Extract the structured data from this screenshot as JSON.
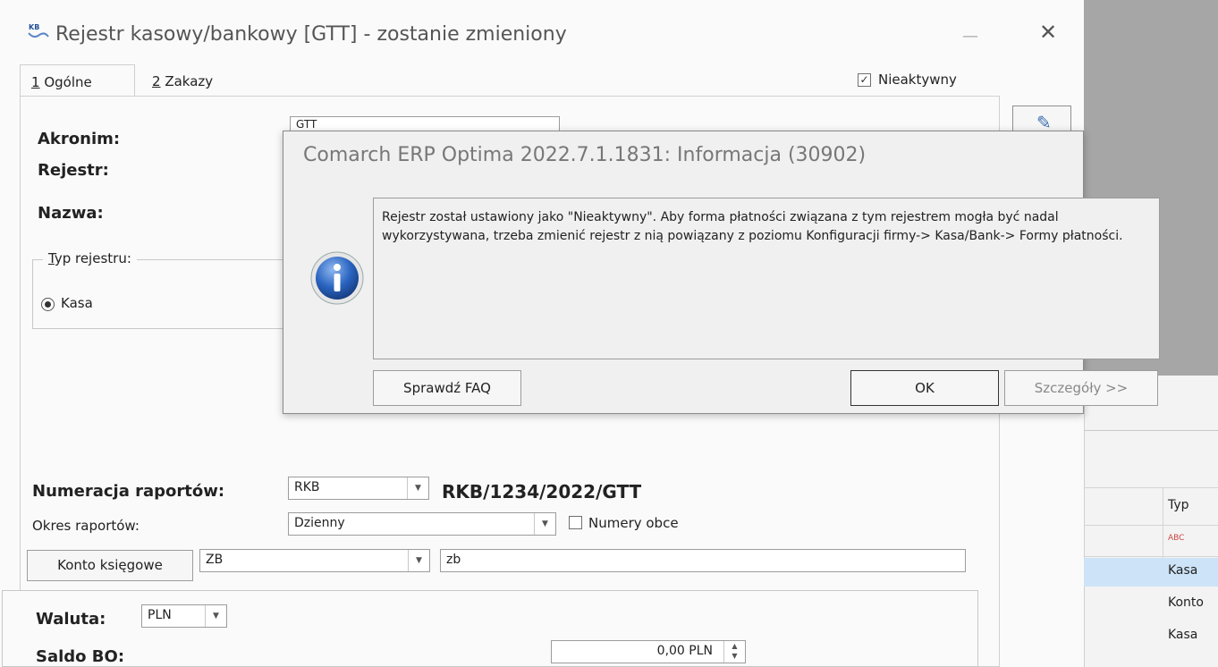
{
  "window": {
    "title": "Rejestr kasowy/bankowy [GTT] - zostanie zmieniony",
    "minimize_glyph": "—",
    "close_glyph": "✕",
    "icon": "kb-register-icon"
  },
  "tabs": [
    {
      "num": "1",
      "label": " Ogólne"
    },
    {
      "num": "2",
      "label": " Zakazy"
    }
  ],
  "inactive_checkbox": {
    "label": "Nieaktywny",
    "checked": true
  },
  "form": {
    "acronym_label": "Akronim:",
    "acronym_value": "GTT",
    "register_label": "Rejestr:",
    "name_label": "Nazwa:",
    "type_group_first": "T",
    "type_group_rest": "yp rejestru:",
    "type_kasa": "Kasa",
    "numbering_label": "Numeracja raportów:",
    "numbering_value": "RKB",
    "numbering_preview": "RKB/1234/2022/GTT",
    "period_label": "Okres raportów:",
    "period_value": "Dzienny",
    "foreign_numbers_label": "Numery obce",
    "account_button": "Konto księgowe",
    "account_value": "ZB",
    "account_desc": "zb",
    "currency_label": "Waluta:",
    "currency_value": "PLN",
    "saldo_label": "Saldo BO:",
    "saldo_value": "0,00 PLN"
  },
  "background_grid": {
    "col_header": "Typ",
    "filter_glyph": "ABC",
    "rows": [
      "Kasa",
      "Konto",
      "Kasa"
    ]
  },
  "dialog": {
    "title": "Comarch ERP Optima 2022.7.1.1831: Informacja (30902)",
    "message": "Rejestr został ustawiony jako \"Nieaktywny\". Aby forma płatności związana z tym rejestrem mogła być nadal wykorzystywana, trzeba zmienić rejestr z nią powiązany z poziomu Konfiguracji firmy-> Kasa/Bank-> Formy płatności.",
    "faq_button": "Sprawdź FAQ",
    "ok_button": "OK",
    "details_button": "Szczegóły >>",
    "icon": "info-icon"
  },
  "colors": {
    "info_blue": "#2a64c0",
    "selection": "#cde3f7",
    "backdrop_gray": "#a6a6a6"
  }
}
